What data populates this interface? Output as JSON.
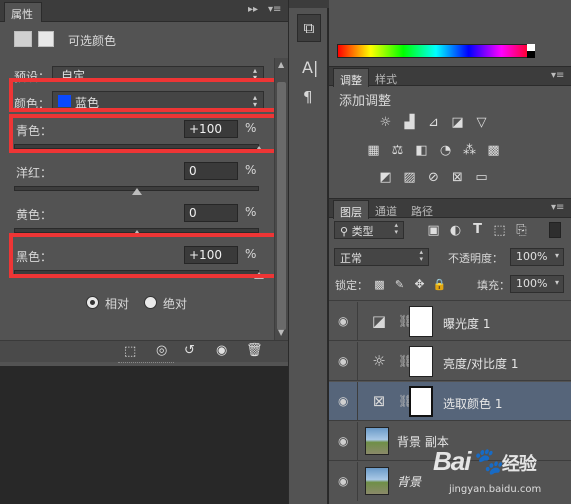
{
  "properties_panel": {
    "tab_label": "属性",
    "collapse_glyph": "▸▸",
    "menu_glyph": "▾≡",
    "title": "可选颜色",
    "preset": {
      "label": "预设：",
      "value": "自定"
    },
    "colors": {
      "label": "颜色：",
      "value": "蓝色",
      "swatch": "#0a49ff"
    },
    "sliders": [
      {
        "label": "青色：",
        "value": "+100",
        "unit": "%",
        "thumb_fraction": 1.0
      },
      {
        "label": "洋红：",
        "value": "0",
        "unit": "%",
        "thumb_fraction": 0.5
      },
      {
        "label": "黄色：",
        "value": "0",
        "unit": "%",
        "thumb_fraction": 0.5
      },
      {
        "label": "黑色：",
        "value": "+100",
        "unit": "%",
        "thumb_fraction": 1.0
      }
    ],
    "method": {
      "relative": "相对",
      "absolute": "绝对",
      "selected": "relative"
    }
  },
  "tool_strip": {
    "tools": [
      "cube-3d",
      "text-A",
      "paragraph-pilcrow"
    ]
  },
  "adjustments_panel": {
    "tabs": [
      "调整",
      "样式"
    ],
    "active_tab": "调整",
    "heading": "添加调整"
  },
  "layers_panel": {
    "tabs": [
      "图层",
      "通道",
      "路径"
    ],
    "active_tab": "图层",
    "filter_label": "类型",
    "blend_mode": "正常",
    "opacity_label": "不透明度：",
    "opacity_value": "100%",
    "lock_label": "锁定：",
    "fill_label": "填充：",
    "fill_value": "100%",
    "layers": [
      {
        "name": "曝光度 1",
        "type": "adjustment",
        "icon": "exposure-icon",
        "selected": false
      },
      {
        "name": "亮度/对比度 1",
        "type": "adjustment",
        "icon": "brightness-icon",
        "selected": false
      },
      {
        "name": "选取颜色 1",
        "type": "adjustment",
        "icon": "selective-color-icon",
        "selected": true
      },
      {
        "name": "背景 副本",
        "type": "image",
        "selected": false
      },
      {
        "name": "背景",
        "type": "image",
        "selected": false
      }
    ]
  },
  "watermark": {
    "brand": "Bai",
    "sub": "经验",
    "url": "jingyan.baidu.com"
  },
  "colors": {
    "highlight": "#ee3535",
    "selected_layer": "#56657a"
  }
}
